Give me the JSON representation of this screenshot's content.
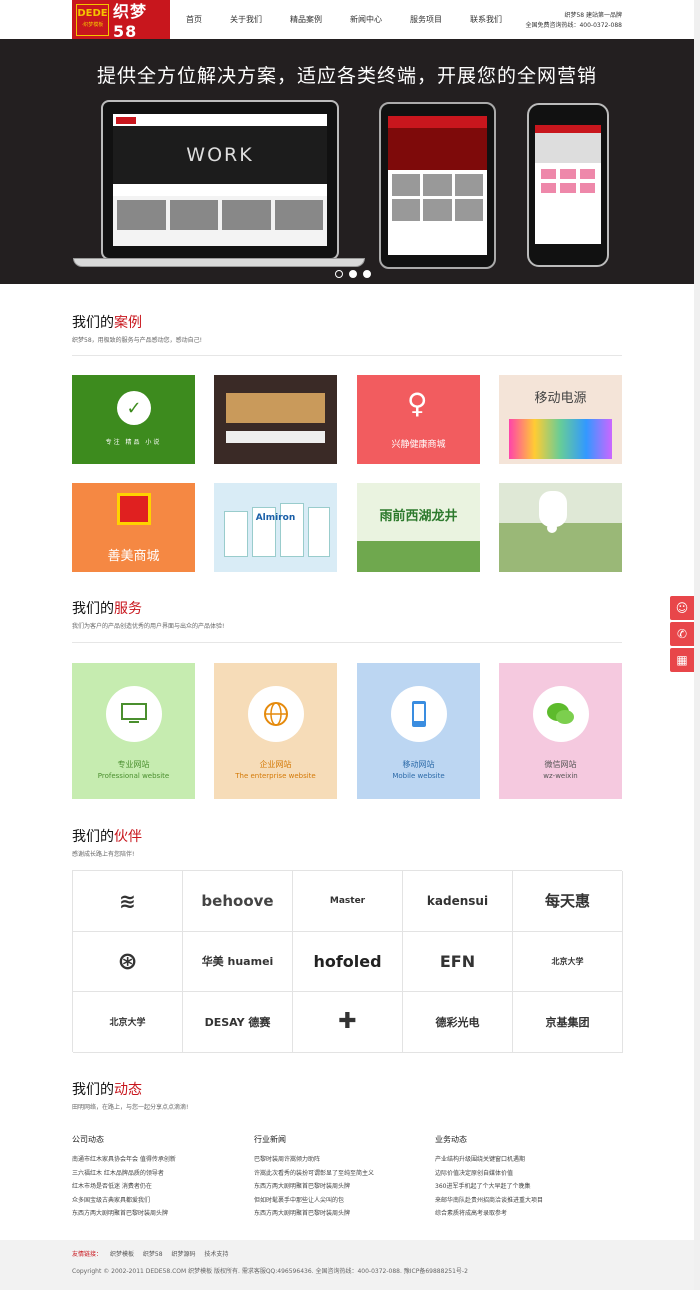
{
  "header": {
    "logo_left": "DEDE",
    "logo_left_sub": "·织梦模板",
    "logo_right": "织梦58",
    "nav": [
      "首页",
      "关于我们",
      "精品案例",
      "新闻中心",
      "服务项目",
      "联系我们"
    ],
    "info_line1": "织梦58 建站第一品牌",
    "info_line2": "全国免费咨询热线：400-0372-088"
  },
  "banner": {
    "title": "提供全方位解决方案，适应各类终端，开展您的全网营销",
    "laptop_hero": "WORK"
  },
  "cases": {
    "title_a": "我们的",
    "title_b": "案例",
    "subtitle": "织梦58，用极致的服务与产品感动您，感动自己!",
    "items": [
      {
        "label": "专注 精品 小说",
        "color": "#3d8b1e"
      },
      {
        "label": "",
        "color": "#3a2a26"
      },
      {
        "label": "兴静健康商城",
        "color": "#f25c5f"
      },
      {
        "label": "移动电源",
        "color": "#f4e4d8"
      },
      {
        "label": "善美商城",
        "color": "#f58843"
      },
      {
        "label": "Almiron",
        "color": "#d9ecf6"
      },
      {
        "label": "雨前西湖龙井",
        "color": "#eaf3e0"
      },
      {
        "label": "",
        "color": "#9ab877"
      }
    ]
  },
  "services": {
    "title_a": "我们的",
    "title_b": "服务",
    "subtitle": "我们为客户的产品创造优秀的用户界面与出众的产品体验!",
    "items": [
      {
        "name": "专业网站",
        "en": "Professional website",
        "bg": "#c6ecb0",
        "fg": "#4a8f2e",
        "icon": "monitor-icon"
      },
      {
        "name": "企业网站",
        "en": "The enterprise website",
        "bg": "#f6dcb8",
        "fg": "#d47a08",
        "icon": "globe-icon"
      },
      {
        "name": "移动网站",
        "en": "Mobile website",
        "bg": "#bcd6f2",
        "fg": "#2c6aa8",
        "icon": "mobile-icon"
      },
      {
        "name": "微信网站",
        "en": "wz-weixin",
        "bg": "#f5c9df",
        "fg": "#555555",
        "icon": "wechat-icon"
      }
    ]
  },
  "partners": {
    "title_a": "我们的",
    "title_b": "伙伴",
    "subtitle": "感谢成长路上有您陪伴!",
    "logos": [
      "≋",
      "behoove",
      "Master",
      "kadensui",
      "每天惠",
      "⊛",
      "华美 huamei",
      "hofoled",
      "EFN",
      "北京大学",
      "北京大学",
      "DESAY 德赛",
      "✚",
      "德彩光电",
      "京基集团"
    ]
  },
  "news": {
    "title_a": "我们的",
    "title_b": "动态",
    "subtitle": "田明网络，在路上，与您一起分享点点滴滴!",
    "cols": [
      {
        "title": "公司动态",
        "items": [
          "南通市红木家具协会年会 值得传承创新",
          "三六福红木 红木品牌品质的领导者",
          "红木市场是否低迷 消费者仍在",
          "众多国宝级古典家具都爱我们",
          "东西方两大剧明聚首巴黎时装周头牌"
        ]
      },
      {
        "title": "行业新闻",
        "items": [
          "巴黎时装周许嵩倾力助阵",
          "许嵩此次看秀的装扮可谓彰显了至纯至简主义",
          "东西方两大剧明聚首巴黎时装周头牌",
          "但如时髦裹手中那些让人尖叫的包",
          "东西方两大剧明聚首巴黎时装周头牌"
        ]
      },
      {
        "title": "业务动态",
        "items": [
          "产业结构升级围绕关键窗口机遇期",
          "边际价值决定原创自媒体价值",
          "360进军手机起了个大早赶了个晚集",
          "来邮华南队赴贵州招商洽谈推进重大项目",
          "综合素质将成高考录取参考"
        ]
      }
    ]
  },
  "footer": {
    "friend_label": "友情链接：",
    "links": [
      "织梦模板",
      "织梦58",
      "织梦源码",
      "技术支持"
    ],
    "copyright": "Copyright © 2002-2011 DEDE58.COM 织梦模板 版权所有. 需求客服QQ:496596436. 全国咨询热线：400-0372-088. 豫ICP备69888251号-2"
  }
}
